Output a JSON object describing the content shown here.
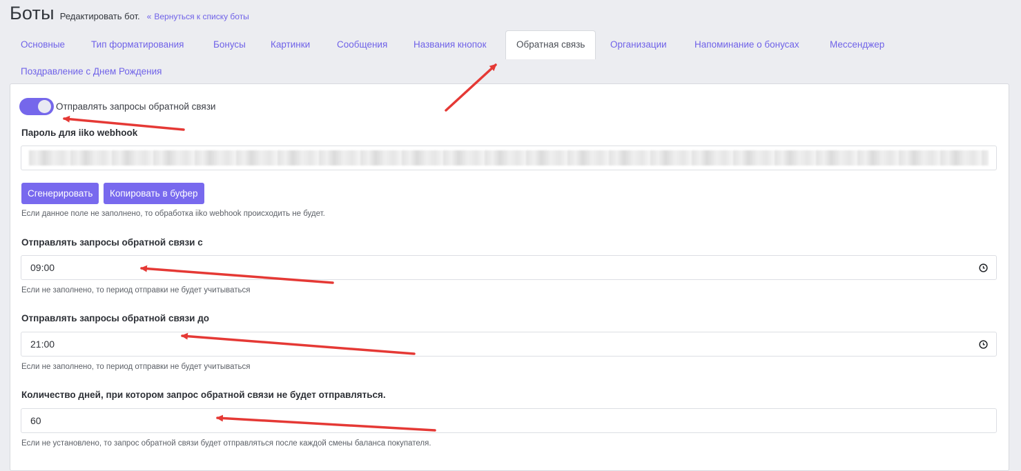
{
  "header": {
    "title": "Боты",
    "subtitle": "Редактировать бот.",
    "back_link": "Вернуться к списку боты"
  },
  "tabs": [
    {
      "label": "Основные"
    },
    {
      "label": "Тип форматирования"
    },
    {
      "label": "Бонусы"
    },
    {
      "label": "Картинки"
    },
    {
      "label": "Сообщения"
    },
    {
      "label": "Названия кнопок"
    },
    {
      "label": "Обратная связь",
      "active": true
    },
    {
      "label": "Организации"
    },
    {
      "label": "Напоминание о бонусах"
    },
    {
      "label": "Мессенджер"
    },
    {
      "label": "Поздравление с Днем Рождения"
    }
  ],
  "form": {
    "toggle_label": "Отправлять запросы обратной связи",
    "toggle_on": true,
    "password_label": "Пароль для iiko webhook",
    "generate_button": "Сгенерировать",
    "copy_button": "Копировать в буфер",
    "password_hint": "Если данное поле не заполнено, то обработка iiko webhook происходить не будет.",
    "from_label": "Отправлять запросы обратной связи с",
    "from_value": "09:00",
    "from_hint": "Если не заполнено, то период отправки не будет учитываться",
    "to_label": "Отправлять запросы обратной связи до",
    "to_value": "21:00",
    "to_hint": "Если не заполнено, то период отправки не будет учитываться",
    "days_label": "Количество дней, при котором запрос обратной связи не будет отправляться.",
    "days_value": "60",
    "days_hint": "Если не установлено, то запрос обратной связи будет отправляться после каждой смены баланса покупателя."
  },
  "colors": {
    "accent": "#7567eb",
    "link": "#6f62e8",
    "annotation_arrow": "#e53935"
  }
}
